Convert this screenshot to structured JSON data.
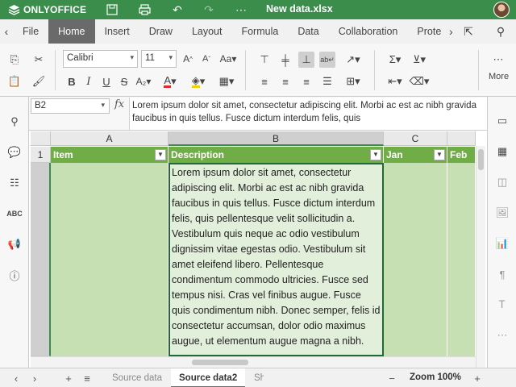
{
  "app": {
    "brand": "ONLYOFFICE",
    "doc_title": "New data.xlsx",
    "accent": "#3a8d4a"
  },
  "menu": {
    "tabs": [
      {
        "label": "File"
      },
      {
        "label": "Home",
        "active": true
      },
      {
        "label": "Insert"
      },
      {
        "label": "Draw"
      },
      {
        "label": "Layout"
      },
      {
        "label": "Formula"
      },
      {
        "label": "Data"
      },
      {
        "label": "Collaboration"
      },
      {
        "label": "Prote"
      }
    ]
  },
  "toolbar": {
    "font_name": "Calibri",
    "font_size": "11",
    "more_label": "More"
  },
  "formula_bar": {
    "cell_ref": "B2",
    "fx": "fx",
    "content": "Lorem ipsum dolor sit amet, consectetur adipiscing elit. Morbi ac est ac nibh gravida faucibus in quis tellus. Fusce dictum interdum felis, quis"
  },
  "grid": {
    "columns": [
      "A",
      "B",
      "C"
    ],
    "rows": [
      "1"
    ],
    "headers": [
      "Item",
      "Description",
      "Jan",
      "Feb"
    ],
    "active_cell_text": "Lorem ipsum dolor sit amet, consectetur adipiscing elit. Morbi ac est ac nibh gravida faucibus in quis tellus. Fusce dictum interdum felis, quis pellentesque velit sollicitudin a. Vestibulum quis neque ac odio vestibulum dignissim vitae egestas odio. Vestibulum sit amet eleifend libero. Pellentesque condimentum commodo ultricies. Fusce sed tempus nisi. Cras vel finibus augue. Fusce quis condimentum nibh. Donec semper, felis id consectetur accumsan, dolor odio maximus augue, ut elementum augue magna a nibh.",
    "header_fill": "#70ad47",
    "data_fill": "#c6e0b4"
  },
  "status": {
    "sheets": [
      {
        "label": "Source data"
      },
      {
        "label": "Source data2",
        "active": true
      },
      {
        "label": "Sh"
      }
    ],
    "zoom": "Zoom 100%"
  }
}
